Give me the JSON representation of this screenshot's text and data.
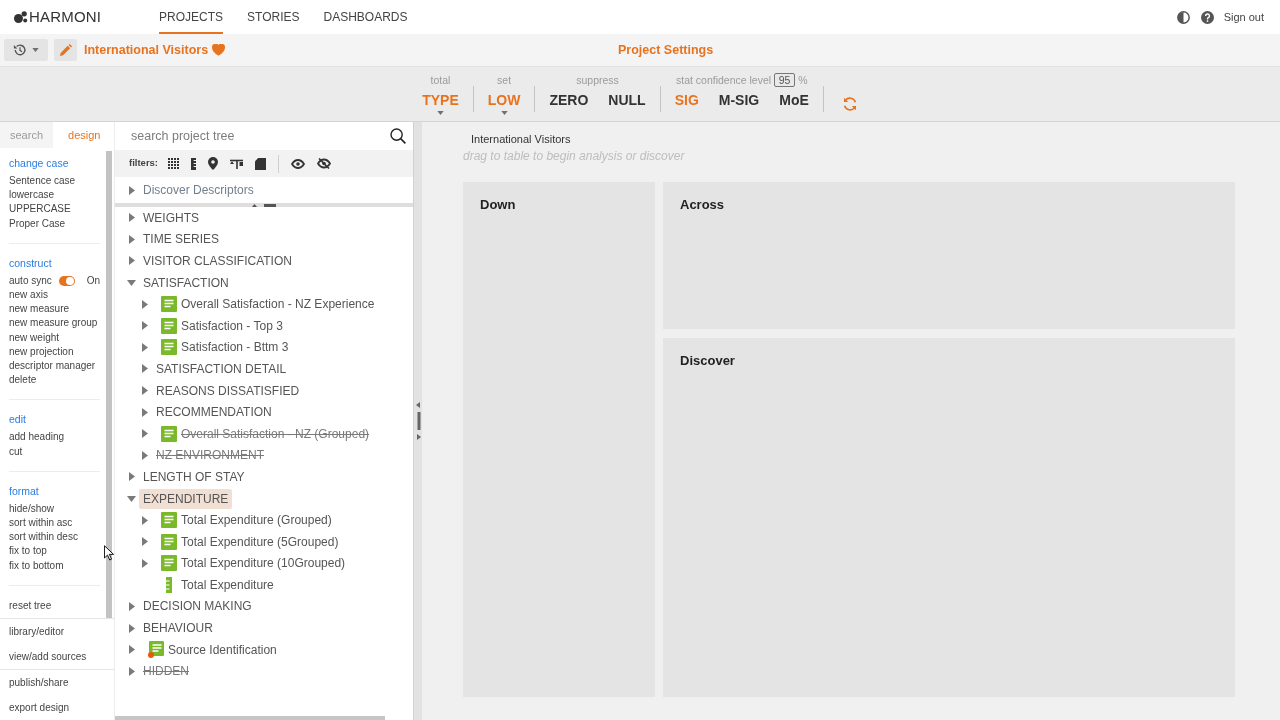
{
  "app": {
    "logo": "HARMONI",
    "nav_tabs": [
      {
        "label": "PROJECTS",
        "selected": true
      },
      {
        "label": "STORIES",
        "selected": false
      },
      {
        "label": "DASHBOARDS",
        "selected": false
      }
    ],
    "sign_out": "Sign out"
  },
  "project_bar": {
    "title": "International Visitors",
    "favorite": true,
    "settings_label": "Project Settings"
  },
  "settings_toolbar": {
    "groups": [
      {
        "caption": "total",
        "options": [
          {
            "label": "TYPE",
            "selected": true,
            "dropdown": true
          }
        ]
      },
      {
        "caption": "set",
        "options": [
          {
            "label": "LOW",
            "selected": true,
            "dropdown": true
          }
        ]
      },
      {
        "caption": "suppress",
        "options": [
          {
            "label": "ZERO",
            "selected": false,
            "dropdown": false
          },
          {
            "label": "NULL",
            "selected": false,
            "dropdown": false
          }
        ]
      },
      {
        "caption": "stat confidence level",
        "confidence": "95",
        "unit": "%",
        "options": [
          {
            "label": "SIG",
            "selected": true,
            "dropdown": false
          },
          {
            "label": "M-SIG",
            "selected": false,
            "dropdown": false
          },
          {
            "label": "MoE",
            "selected": false,
            "dropdown": false
          }
        ]
      }
    ]
  },
  "side_panel": {
    "tabs": [
      {
        "label": "search",
        "selected": false
      },
      {
        "label": "design",
        "selected": true
      }
    ],
    "sections": [
      {
        "heading": "change case",
        "items": [
          {
            "kind": "action",
            "label": "Sentence case"
          },
          {
            "kind": "action",
            "label": "lowercase"
          },
          {
            "kind": "action",
            "label": "UPPERCASE"
          },
          {
            "kind": "action",
            "label": "Proper Case"
          }
        ]
      },
      {
        "heading": "construct",
        "items": [
          {
            "kind": "toggle",
            "label": "auto sync",
            "on": true,
            "state_label": "On"
          },
          {
            "kind": "action",
            "label": "new axis"
          },
          {
            "kind": "action",
            "label": "new measure"
          },
          {
            "kind": "action",
            "label": "new measure group"
          },
          {
            "kind": "action",
            "label": "new weight"
          },
          {
            "kind": "action",
            "label": "new projection"
          },
          {
            "kind": "action",
            "label": "descriptor manager"
          },
          {
            "kind": "action",
            "label": "delete"
          }
        ]
      },
      {
        "heading": "edit",
        "items": [
          {
            "kind": "action",
            "label": "add heading"
          },
          {
            "kind": "action",
            "label": "cut"
          }
        ]
      },
      {
        "heading": "format",
        "items": [
          {
            "kind": "action",
            "label": "hide/show"
          },
          {
            "kind": "action",
            "label": "sort within asc"
          },
          {
            "kind": "action",
            "label": "sort within desc"
          },
          {
            "kind": "action",
            "label": "fix to top"
          },
          {
            "kind": "action",
            "label": "fix to bottom"
          }
        ]
      },
      {
        "items": [
          {
            "kind": "action",
            "label": "reset tree"
          }
        ]
      }
    ],
    "footer_links": [
      [
        "library/editor",
        "view/add sources"
      ],
      [
        "publish/share",
        "export design"
      ]
    ]
  },
  "project_tree": {
    "search": {
      "placeholder": "search project tree"
    },
    "filters_label": "filters:",
    "discover": {
      "label": "Discover Descriptors",
      "expanded": false
    },
    "nodes": [
      {
        "label": "WEIGHTS",
        "kind": "folder",
        "expanded": false,
        "hidden": false,
        "selected": false
      },
      {
        "label": "TIME SERIES",
        "kind": "folder",
        "expanded": false,
        "hidden": false,
        "selected": false
      },
      {
        "label": "VISITOR CLASSIFICATION",
        "kind": "folder",
        "expanded": false,
        "hidden": false,
        "selected": false
      },
      {
        "label": "SATISFACTION",
        "kind": "folder",
        "expanded": true,
        "hidden": false,
        "selected": false,
        "children": [
          {
            "label": "Overall Satisfaction - NZ Experience",
            "kind": "variable",
            "expanded": false,
            "hidden": false,
            "selected": false
          },
          {
            "label": "Satisfaction - Top 3",
            "kind": "variable",
            "expanded": false,
            "hidden": false,
            "selected": false
          },
          {
            "label": "Satisfaction - Bttm 3",
            "kind": "variable",
            "expanded": false,
            "hidden": false,
            "selected": false
          },
          {
            "label": "SATISFACTION DETAIL",
            "kind": "folder",
            "expanded": false,
            "hidden": false,
            "selected": false
          },
          {
            "label": "REASONS DISSATISFIED",
            "kind": "folder",
            "expanded": false,
            "hidden": false,
            "selected": false
          },
          {
            "label": "RECOMMENDATION",
            "kind": "folder",
            "expanded": false,
            "hidden": false,
            "selected": false
          },
          {
            "label": "Overall Satisfaction - NZ (Grouped)",
            "kind": "variable",
            "expanded": false,
            "hidden": true,
            "selected": false
          },
          {
            "label": "NZ ENVIRONMENT",
            "kind": "folder",
            "expanded": false,
            "hidden": true,
            "selected": false
          }
        ]
      },
      {
        "label": "LENGTH OF STAY",
        "kind": "folder",
        "expanded": false,
        "hidden": false,
        "selected": false
      },
      {
        "label": "EXPENDITURE",
        "kind": "folder",
        "expanded": true,
        "hidden": false,
        "selected": true,
        "children": [
          {
            "label": "Total Expenditure (Grouped)",
            "kind": "variable",
            "expanded": false,
            "hidden": false,
            "selected": false
          },
          {
            "label": "Total Expenditure (5Grouped)",
            "kind": "variable",
            "expanded": false,
            "hidden": false,
            "selected": false
          },
          {
            "label": "Total Expenditure (10Grouped)",
            "kind": "variable",
            "expanded": false,
            "hidden": false,
            "selected": false
          },
          {
            "label": "Total Expenditure",
            "kind": "measure",
            "hidden": false,
            "selected": false
          }
        ]
      },
      {
        "label": "DECISION MAKING",
        "kind": "folder",
        "expanded": false,
        "hidden": false,
        "selected": false
      },
      {
        "label": "BEHAVIOUR",
        "kind": "folder",
        "expanded": false,
        "hidden": false,
        "selected": false
      },
      {
        "label": "Source Identification",
        "kind": "source",
        "expanded": false,
        "hidden": false,
        "selected": false
      },
      {
        "label": "HIDDEN",
        "kind": "folder",
        "expanded": false,
        "hidden": true,
        "selected": false
      }
    ]
  },
  "workspace": {
    "breadcrumb": "International Visitors",
    "hint": "drag to table to begin analysis or discover",
    "drop_zones": [
      {
        "title": "Down"
      },
      {
        "title": "Across"
      },
      {
        "title": "Discover"
      }
    ]
  }
}
